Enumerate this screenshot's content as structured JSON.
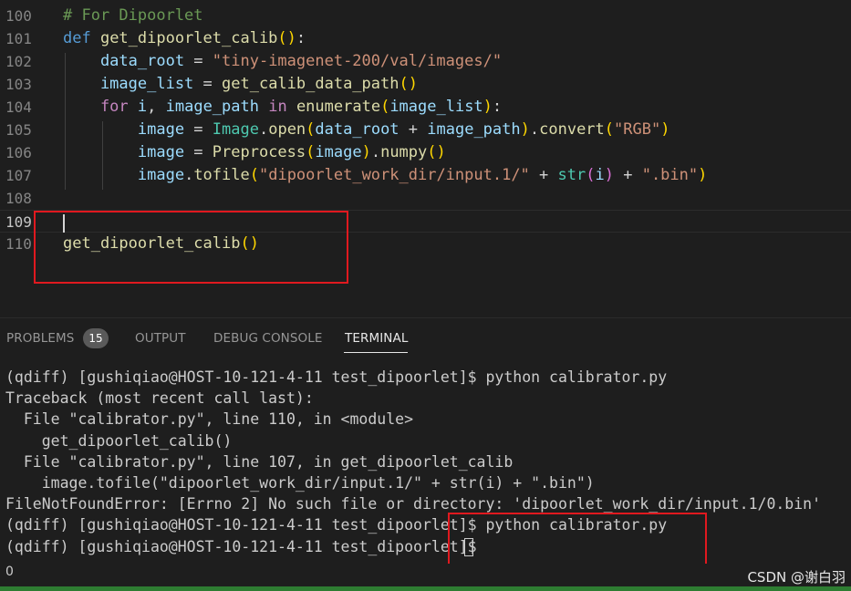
{
  "editor": {
    "lines": [
      {
        "n": "100",
        "tokens": [
          {
            "t": "# For Dipoorlet",
            "c": "t-comment"
          }
        ]
      },
      {
        "n": "101",
        "tokens": [
          {
            "t": "def ",
            "c": "t-kw"
          },
          {
            "t": "get_dipoorlet_calib",
            "c": "t-fn"
          },
          {
            "t": "()",
            "c": "t-p1"
          },
          {
            "t": ":",
            "c": "t-op"
          }
        ]
      },
      {
        "n": "102",
        "tokens": [
          {
            "t": "    data_root",
            "c": "t-var"
          },
          {
            "t": " = ",
            "c": "t-op"
          },
          {
            "t": "\"tiny-imagenet-200/val/images/\"",
            "c": "t-str"
          }
        ]
      },
      {
        "n": "103",
        "tokens": [
          {
            "t": "    image_list",
            "c": "t-var"
          },
          {
            "t": " = ",
            "c": "t-op"
          },
          {
            "t": "get_calib_data_path",
            "c": "t-fn"
          },
          {
            "t": "()",
            "c": "t-p1"
          }
        ]
      },
      {
        "n": "104",
        "tokens": [
          {
            "t": "    for ",
            "c": "t-ctl"
          },
          {
            "t": "i",
            "c": "t-var"
          },
          {
            "t": ", ",
            "c": "t-op"
          },
          {
            "t": "image_path",
            "c": "t-var"
          },
          {
            "t": " in ",
            "c": "t-ctl"
          },
          {
            "t": "enumerate",
            "c": "t-fn"
          },
          {
            "t": "(",
            "c": "t-p1"
          },
          {
            "t": "image_list",
            "c": "t-var"
          },
          {
            "t": ")",
            "c": "t-p1"
          },
          {
            "t": ":",
            "c": "t-op"
          }
        ]
      },
      {
        "n": "105",
        "tokens": [
          {
            "t": "        image",
            "c": "t-var"
          },
          {
            "t": " = ",
            "c": "t-op"
          },
          {
            "t": "Image",
            "c": "t-cls"
          },
          {
            "t": ".",
            "c": "t-op"
          },
          {
            "t": "open",
            "c": "t-fn"
          },
          {
            "t": "(",
            "c": "t-p1"
          },
          {
            "t": "data_root",
            "c": "t-var"
          },
          {
            "t": " + ",
            "c": "t-op"
          },
          {
            "t": "image_path",
            "c": "t-var"
          },
          {
            "t": ")",
            "c": "t-p1"
          },
          {
            "t": ".",
            "c": "t-op"
          },
          {
            "t": "convert",
            "c": "t-fn"
          },
          {
            "t": "(",
            "c": "t-p1"
          },
          {
            "t": "\"RGB\"",
            "c": "t-str"
          },
          {
            "t": ")",
            "c": "t-p1"
          }
        ]
      },
      {
        "n": "106",
        "tokens": [
          {
            "t": "        image",
            "c": "t-var"
          },
          {
            "t": " = ",
            "c": "t-op"
          },
          {
            "t": "Preprocess",
            "c": "t-fn"
          },
          {
            "t": "(",
            "c": "t-p1"
          },
          {
            "t": "image",
            "c": "t-var"
          },
          {
            "t": ")",
            "c": "t-p1"
          },
          {
            "t": ".",
            "c": "t-op"
          },
          {
            "t": "numpy",
            "c": "t-fn"
          },
          {
            "t": "()",
            "c": "t-p1"
          }
        ]
      },
      {
        "n": "107",
        "tokens": [
          {
            "t": "        image",
            "c": "t-var"
          },
          {
            "t": ".",
            "c": "t-op"
          },
          {
            "t": "tofile",
            "c": "t-fn"
          },
          {
            "t": "(",
            "c": "t-p1"
          },
          {
            "t": "\"dipoorlet_work_dir/input.1/\"",
            "c": "t-str"
          },
          {
            "t": " + ",
            "c": "t-op"
          },
          {
            "t": "str",
            "c": "t-cls"
          },
          {
            "t": "(",
            "c": "t-p2"
          },
          {
            "t": "i",
            "c": "t-var"
          },
          {
            "t": ")",
            "c": "t-p2"
          },
          {
            "t": " + ",
            "c": "t-op"
          },
          {
            "t": "\".bin\"",
            "c": "t-str"
          },
          {
            "t": ")",
            "c": "t-p1"
          }
        ]
      },
      {
        "n": "108",
        "tokens": []
      },
      {
        "n": "109",
        "tokens": []
      },
      {
        "n": "110",
        "tokens": [
          {
            "t": "get_dipoorlet_calib",
            "c": "t-fn"
          },
          {
            "t": "()",
            "c": "t-p1"
          }
        ]
      }
    ],
    "active_line": "109"
  },
  "panel": {
    "tabs": [
      "PROBLEMS",
      "OUTPUT",
      "DEBUG CONSOLE",
      "TERMINAL"
    ],
    "active_tab": "TERMINAL",
    "problems_count": "15"
  },
  "terminal": {
    "lines": [
      "(qdiff) [gushiqiao@HOST-10-121-4-11 test_dipoorlet]$ python calibrator.py",
      "Traceback (most recent call last):",
      "  File \"calibrator.py\", line 110, in <module>",
      "    get_dipoorlet_calib()",
      "  File \"calibrator.py\", line 107, in get_dipoorlet_calib",
      "    image.tofile(\"dipoorlet_work_dir/input.1/\" + str(i) + \".bin\")",
      "FileNotFoundError: [Errno 2] No such file or directory: 'dipoorlet_work_dir/input.1/0.bin'",
      "(qdiff) [gushiqiao@HOST-10-121-4-11 test_dipoorlet]$ python calibrator.py",
      "(qdiff) [gushiqiao@HOST-10-121-4-11 test_dipoorlet]$ "
    ]
  },
  "status": {
    "left_text": "0",
    "watermark": "CSDN @谢白羽"
  },
  "colors": {
    "annotation_box": "#e0191f",
    "background": "#1e1e1e"
  }
}
